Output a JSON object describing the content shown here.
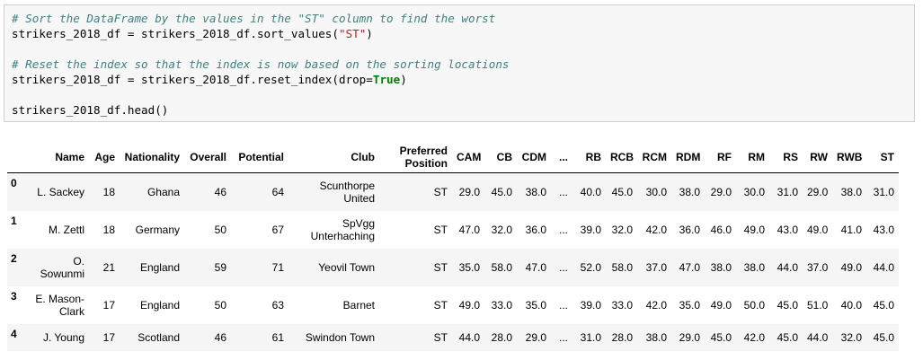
{
  "code": {
    "comment1": "# Sort the DataFrame by the values in the \"ST\" column to find the worst",
    "line1_pre": "strikers_2018_df = strikers_2018_df.sort_values(",
    "line1_str": "\"ST\"",
    "line1_post": ")",
    "comment2": "# Reset the index so that the index is now based on the sorting locations",
    "line2_pre": "strikers_2018_df = strikers_2018_df.reset_index(drop=",
    "line2_kw": "True",
    "line2_post": ")",
    "line3": "strikers_2018_df.head()"
  },
  "table": {
    "columns": [
      "",
      "Name",
      "Age",
      "Nationality",
      "Overall",
      "Potential",
      "Club",
      "Preferred Position",
      "CAM",
      "CB",
      "CDM",
      "...",
      "RB",
      "RCB",
      "RCM",
      "RDM",
      "RF",
      "RM",
      "RS",
      "RW",
      "RWB",
      "ST"
    ],
    "rows": [
      [
        "0",
        "L. Sackey",
        "18",
        "Ghana",
        "46",
        "64",
        "Scunthorpe United",
        "ST",
        "29.0",
        "45.0",
        "38.0",
        "...",
        "40.0",
        "45.0",
        "30.0",
        "38.0",
        "29.0",
        "30.0",
        "31.0",
        "29.0",
        "38.0",
        "31.0"
      ],
      [
        "1",
        "M. Zettl",
        "18",
        "Germany",
        "50",
        "67",
        "SpVgg Unterhaching",
        "ST",
        "47.0",
        "32.0",
        "36.0",
        "...",
        "39.0",
        "32.0",
        "42.0",
        "36.0",
        "46.0",
        "49.0",
        "43.0",
        "49.0",
        "41.0",
        "43.0"
      ],
      [
        "2",
        "O. Sowunmi",
        "21",
        "England",
        "59",
        "71",
        "Yeovil Town",
        "ST",
        "35.0",
        "58.0",
        "47.0",
        "...",
        "52.0",
        "58.0",
        "37.0",
        "47.0",
        "38.0",
        "38.0",
        "44.0",
        "37.0",
        "49.0",
        "44.0"
      ],
      [
        "3",
        "E. Mason-Clark",
        "17",
        "England",
        "50",
        "63",
        "Barnet",
        "ST",
        "49.0",
        "33.0",
        "35.0",
        "...",
        "39.0",
        "33.0",
        "42.0",
        "35.0",
        "49.0",
        "50.0",
        "45.0",
        "51.0",
        "40.0",
        "45.0"
      ],
      [
        "4",
        "J. Young",
        "17",
        "Scotland",
        "46",
        "61",
        "Swindon Town",
        "ST",
        "44.0",
        "28.0",
        "29.0",
        "...",
        "31.0",
        "28.0",
        "38.0",
        "29.0",
        "45.0",
        "42.0",
        "45.0",
        "44.0",
        "32.0",
        "45.0"
      ]
    ]
  }
}
